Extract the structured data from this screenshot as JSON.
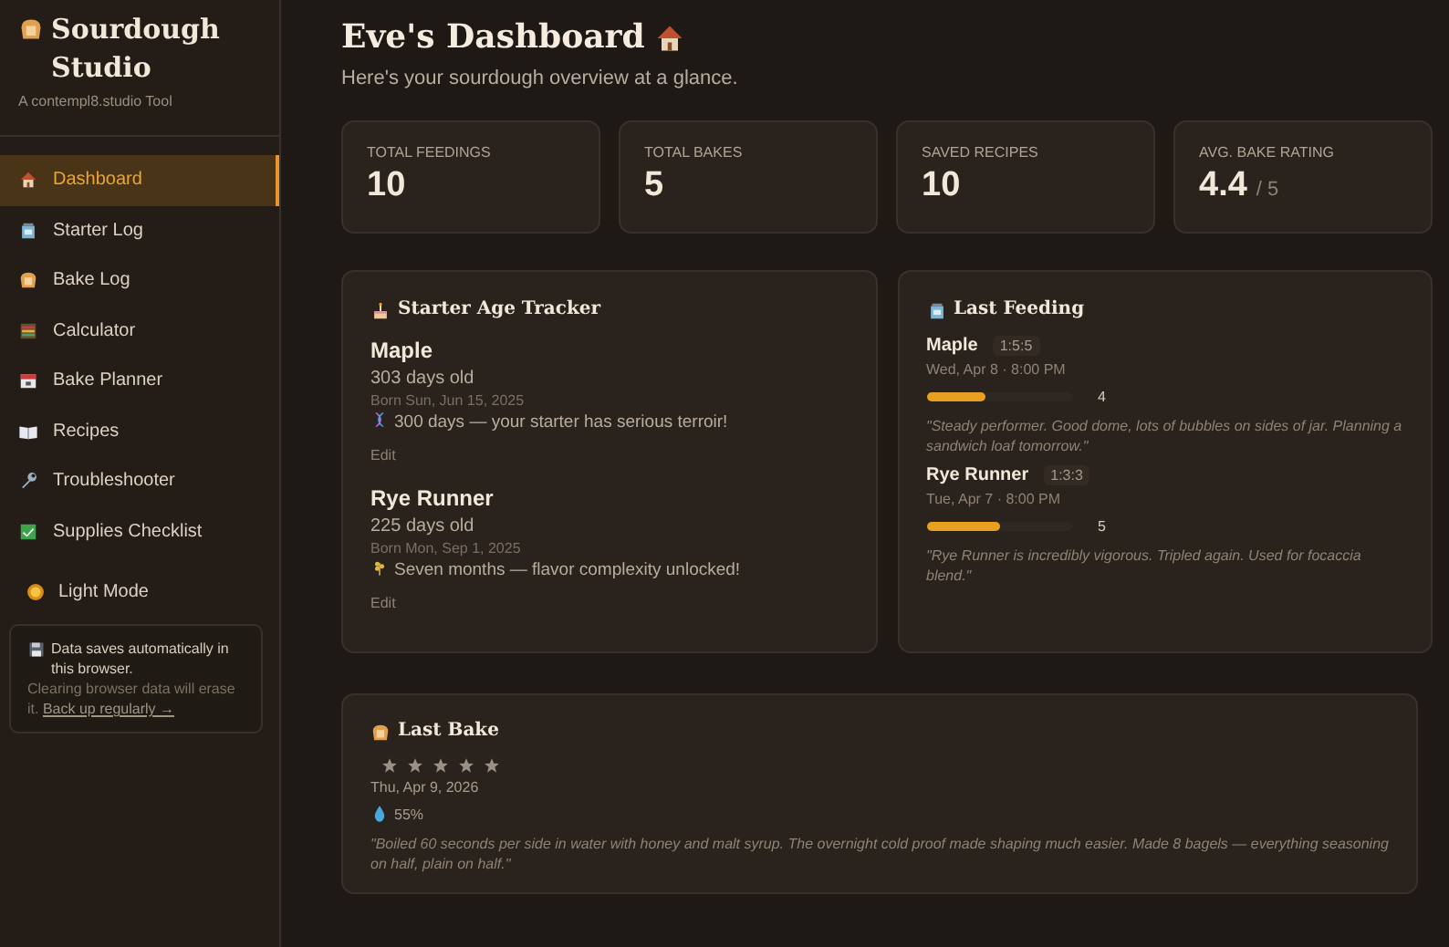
{
  "brand": {
    "title": "Sourdough Studio",
    "subtitle": "A contempl8.studio Tool"
  },
  "nav": [
    {
      "label": "Dashboard",
      "selected": true
    },
    {
      "label": "Starter Log",
      "selected": false
    },
    {
      "label": "Bake Log",
      "selected": false
    },
    {
      "label": "Calculator",
      "selected": false
    },
    {
      "label": "Bake Planner",
      "selected": false
    },
    {
      "label": "Recipes",
      "selected": false
    },
    {
      "label": "Troubleshooter",
      "selected": false
    },
    {
      "label": "Supplies Checklist",
      "selected": false
    }
  ],
  "theme_toggle": {
    "label": "Light Mode"
  },
  "storage_note": {
    "title": "Data saves automatically in this browser.",
    "body": "Clearing browser data will erase it.",
    "link": "Back up regularly →"
  },
  "header": {
    "title": "Eve's Dashboard",
    "subtitle": "Here's your sourdough overview at a glance."
  },
  "stats": [
    {
      "label": "TOTAL FEEDINGS",
      "value": "10"
    },
    {
      "label": "TOTAL BAKES",
      "value": "5"
    },
    {
      "label": "SAVED RECIPES",
      "value": "10"
    },
    {
      "label": "AVG. BAKE RATING",
      "value": "4.4",
      "suffix": "/ 5"
    }
  ],
  "starter_tracker": {
    "title": "Starter Age Tracker",
    "starters": [
      {
        "name": "Maple",
        "age": "303 days old",
        "born": "Born Sun, Jun 15, 2025",
        "milestone": "300 days — your starter has serious terroir!",
        "action": "Edit"
      },
      {
        "name": "Rye Runner",
        "age": "225 days old",
        "born": "Born Mon, Sep 1, 2025",
        "milestone": "Seven months — flavor complexity unlocked!",
        "action": "Edit"
      }
    ]
  },
  "last_feeding": {
    "title": "Last Feeding",
    "entries": [
      {
        "name": "Maple",
        "ratio": "1:5:5",
        "time": "Wed, Apr 8 · 8:00 PM",
        "level": 0.4,
        "score": "4",
        "note": "\"Steady performer. Good dome, lots of bubbles on sides of jar. Planning a sandwich loaf tomorrow.\""
      },
      {
        "name": "Rye Runner",
        "ratio": "1:3:3",
        "time": "Tue, Apr 7 · 8:00 PM",
        "level": 0.5,
        "score": "5",
        "note": "\"Rye Runner is incredibly vigorous. Tripled again. Used for focaccia blend.\""
      }
    ]
  },
  "last_bake": {
    "title": "Last Bake",
    "stars": 5,
    "date": "Thu, Apr 9, 2026",
    "hydration": "55%",
    "note": "\"Boiled 60 seconds per side in water with honey and malt syrup. The overnight cold proof made shaping much easier. Made 8 bagels — everything seasoning on half, plain on half.\""
  }
}
